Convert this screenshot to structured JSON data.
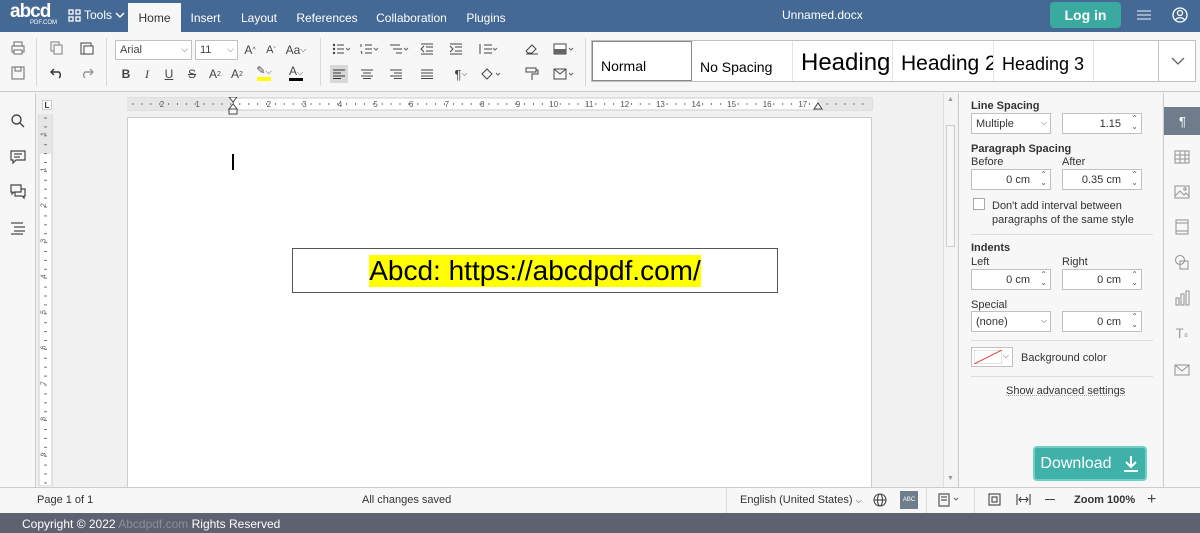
{
  "header": {
    "logo_text": "abcd",
    "logo_sub": "PDF.COM",
    "tools_label": "Tools",
    "tabs": [
      "Home",
      "Insert",
      "Layout",
      "References",
      "Collaboration",
      "Plugins"
    ],
    "active_tab": "Home",
    "doc_title": "Unnamed.docx",
    "login_label": "Log in"
  },
  "toolbar": {
    "font_name": "Arial",
    "font_size": "11",
    "styles": [
      "Normal",
      "No Spacing",
      "Heading 1",
      "Heading 2",
      "Heading 3"
    ],
    "selected_style": "Normal",
    "highlight_color": "#ffff00",
    "font_color": "#000000"
  },
  "document": {
    "textbox_text": "Abcd: https://abcdpdf.com/",
    "highlight": "#ffff00"
  },
  "ruler": {
    "h_ticks": [
      "2",
      "1",
      "1",
      "2",
      "3",
      "4",
      "5",
      "6",
      "7",
      "8",
      "9",
      "10",
      "11",
      "12",
      "13",
      "14",
      "15",
      "16",
      "17"
    ],
    "v_ticks": [
      "1",
      "1",
      "2",
      "3",
      "4",
      "5",
      "6",
      "7",
      "8",
      "9",
      "10"
    ]
  },
  "paragraph_settings": {
    "line_spacing_title": "Line Spacing",
    "line_spacing_type": "Multiple",
    "line_spacing_value": "1.15",
    "paragraph_spacing_title": "Paragraph Spacing",
    "before_label": "Before",
    "before_value": "0 cm",
    "after_label": "After",
    "after_value": "0.35 cm",
    "no_interval_label_1": "Don't add interval between",
    "no_interval_label_2": "paragraphs of the same style",
    "indents_title": "Indents",
    "left_label": "Left",
    "left_value": "0 cm",
    "right_label": "Right",
    "right_value": "0 cm",
    "special_label": "Special",
    "special_value": "(none)",
    "special_indent_value": "0 cm",
    "background_color_label": "Background color",
    "advanced_label": "Show advanced settings"
  },
  "download_label": "Download",
  "status": {
    "page": "Page 1 of 1",
    "saved": "All changes saved",
    "language": "English (United States)",
    "zoom": "Zoom 100%"
  },
  "footer": {
    "copyright": "Copyright © 2022",
    "site": "Abcdpdf.com",
    "rights": "Rights Reserved"
  },
  "colors": {
    "header_bg": "#446995",
    "accent": "#3aa9a0",
    "footer_bg": "#5e6170"
  }
}
